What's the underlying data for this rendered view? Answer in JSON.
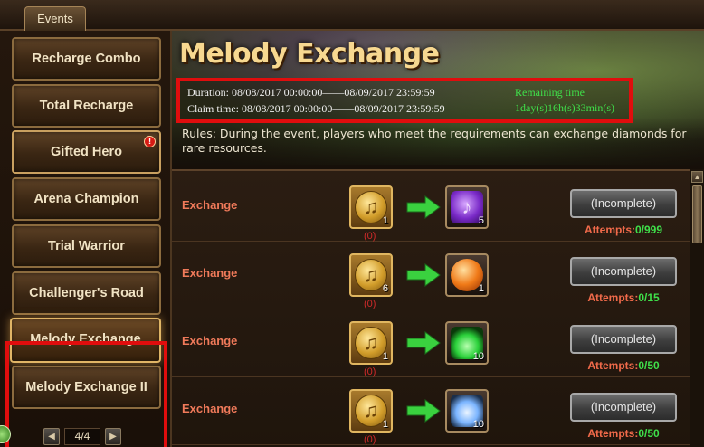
{
  "tabs": {
    "events": "Events"
  },
  "sidebar": {
    "items": [
      {
        "label": "Recharge Combo"
      },
      {
        "label": "Total Recharge"
      },
      {
        "label": "Gifted Hero",
        "badge": "!"
      },
      {
        "label": "Arena Champion"
      },
      {
        "label": "Trial Warrior"
      },
      {
        "label": "Challenger's Road"
      },
      {
        "label": "Melody Exchange",
        "active": true
      },
      {
        "label": "Melody Exchange II"
      }
    ],
    "pager": {
      "prev": "◀",
      "page": "4/4",
      "next": "▶"
    }
  },
  "main": {
    "title": "Melody Exchange",
    "duration": "Duration: 08/08/2017 00:00:00——08/09/2017 23:59:59",
    "claim_time": "Claim time: 08/08/2017 00:00:00——08/09/2017 23:59:59",
    "remaining_label": "Remaining time",
    "remaining_value": "1day(s)16h(s)33min(s)",
    "rules": "Rules: During the event, players who meet the requirements can exchange diamonds for rare resources."
  },
  "exchange_rows": [
    {
      "label": "Exchange",
      "cost": "1",
      "owned": "(0)",
      "reward_count": "5",
      "reward_icon": "purple-music-orb-icon",
      "button": "(Incomplete)",
      "attempts_label": "Attempts:",
      "attempts_value": "0/999"
    },
    {
      "label": "Exchange",
      "cost": "6",
      "owned": "(0)",
      "reward_count": "1",
      "reward_icon": "fire-orb-icon",
      "button": "(Incomplete)",
      "attempts_label": "Attempts:",
      "attempts_value": "0/15"
    },
    {
      "label": "Exchange",
      "cost": "1",
      "owned": "(0)",
      "reward_count": "10",
      "reward_icon": "green-flame-icon",
      "button": "(Incomplete)",
      "attempts_label": "Attempts:",
      "attempts_value": "0/50"
    },
    {
      "label": "Exchange",
      "cost": "1",
      "owned": "(0)",
      "reward_count": "10",
      "reward_icon": "blue-crystal-icon",
      "button": "(Incomplete)",
      "attempts_label": "Attempts:",
      "attempts_value": "0/50"
    }
  ],
  "colors": {
    "highlight_box": "#e00d0d",
    "attempts_value": "#3fe04a",
    "exchange_label": "#f07a5a",
    "title": "#f7d890"
  }
}
